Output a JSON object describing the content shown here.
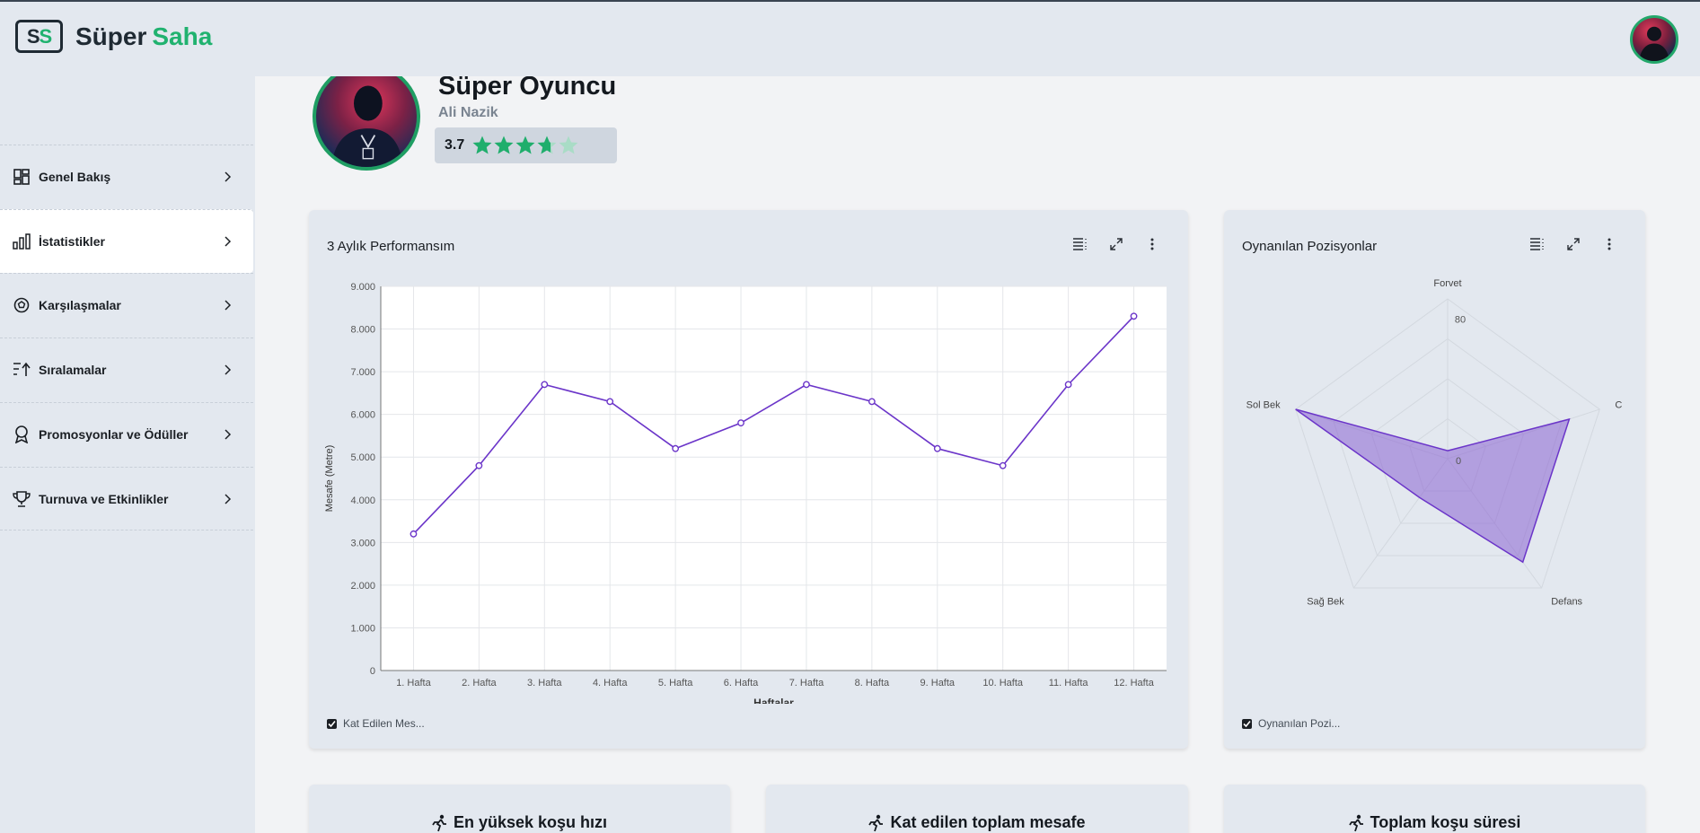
{
  "brand": {
    "mark_left": "S",
    "mark_right": "S",
    "name_left": "Süper",
    "name_right": "Saha",
    "accent": "#20b26f"
  },
  "sidebar": {
    "items": [
      {
        "label": "Genel Bakış",
        "icon": "dashboard-icon"
      },
      {
        "label": "İstatistikler",
        "icon": "bar-chart-icon",
        "active": true
      },
      {
        "label": "Karşılaşmalar",
        "icon": "soccer-ball-icon"
      },
      {
        "label": "Sıralamalar",
        "icon": "sort-ranking-icon"
      },
      {
        "label": "Promosyonlar ve Ödüller",
        "icon": "award-ribbon-icon"
      },
      {
        "label": "Turnuva ve Etkinlikler",
        "icon": "trophy-icon"
      }
    ]
  },
  "profile": {
    "title": "Süper Oyuncu",
    "name": "Ali Nazik",
    "rating": "3.7",
    "rating_value": 3.7,
    "rating_max": 5
  },
  "performance_card": {
    "title": "3 Aylık Performansım",
    "legend": "Kat Edilen Mes..."
  },
  "positions_card": {
    "title": "Oynanılan Pozisyonlar",
    "legend": "Oynanılan Pozi..."
  },
  "stat_cards": [
    {
      "title": "En yüksek koşu hızı",
      "icon": "running-person-icon"
    },
    {
      "title": "Kat edilen toplam mesafe",
      "icon": "running-person-icon"
    },
    {
      "title": "Toplam koşu süresi",
      "icon": "running-person-icon"
    }
  ],
  "chart_data": [
    {
      "type": "line",
      "title": "3 Aylık Performansım",
      "xlabel": "Haftalar",
      "ylabel": "Mesafe (Metre)",
      "categories": [
        "1. Hafta",
        "2. Hafta",
        "3. Hafta",
        "4. Hafta",
        "5. Hafta",
        "6. Hafta",
        "7. Hafta",
        "8. Hafta",
        "9. Hafta",
        "10. Hafta",
        "11. Hafta",
        "12. Hafta"
      ],
      "series": [
        {
          "values": [
            3200,
            4800,
            6700,
            6300,
            5200,
            5800,
            6700,
            6300,
            5200,
            4800,
            6700,
            8300
          ]
        }
      ],
      "ylim": [
        0,
        9000
      ],
      "yticks": [
        "0",
        "1.000",
        "2.000",
        "3.000",
        "4.000",
        "5.000",
        "6.000",
        "7.000",
        "8.000",
        "9.000"
      ],
      "grid": true,
      "color": "#6b35c9"
    },
    {
      "type": "radar",
      "title": "Oynanılan Pozisyonlar",
      "axes": [
        "Forvet",
        "C",
        "Defans",
        "Sağ Bek",
        "Sol Bek"
      ],
      "values": [
        5,
        80,
        80,
        30,
        100
      ],
      "rlim": [
        0,
        100
      ],
      "scale_labels": [
        "0",
        "80"
      ],
      "color": "#8a63d2"
    }
  ]
}
